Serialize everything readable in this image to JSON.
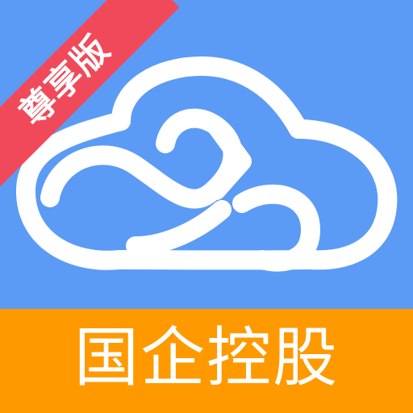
{
  "colors": {
    "background": "#5b9bf5",
    "band": "#ff9900",
    "ribbon": "#f04a5a",
    "foreground": "#ffffff"
  },
  "icon": {
    "logo_icon": "cloud-infinity-icon",
    "ribbon_text": "尊享版",
    "band_text": "国企控股"
  }
}
